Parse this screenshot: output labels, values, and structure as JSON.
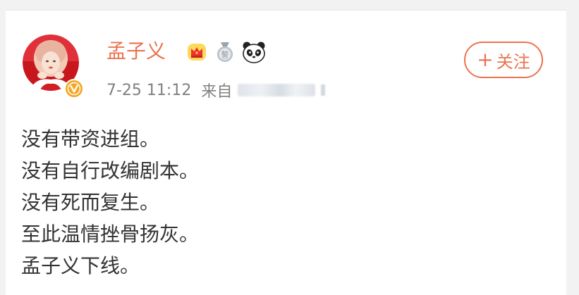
{
  "post": {
    "author": {
      "name": "孟子义",
      "verified_icon": "verified-v-icon",
      "badges": [
        "crown-badge-icon",
        "medal-badge-icon",
        "panda-badge-icon"
      ]
    },
    "time": "7-25 11:12",
    "source_prefix": "来自",
    "follow_button": {
      "plus": "+",
      "label": "关注"
    },
    "lines": [
      "没有带资进组。",
      "没有自行改编剧本。",
      "没有死而复生。",
      "至此温情挫骨扬灰。",
      "孟子义下线。"
    ]
  },
  "colors": {
    "accent": "#eb7350",
    "text": "#333333",
    "meta": "#808080",
    "verified": "#f5a623"
  }
}
